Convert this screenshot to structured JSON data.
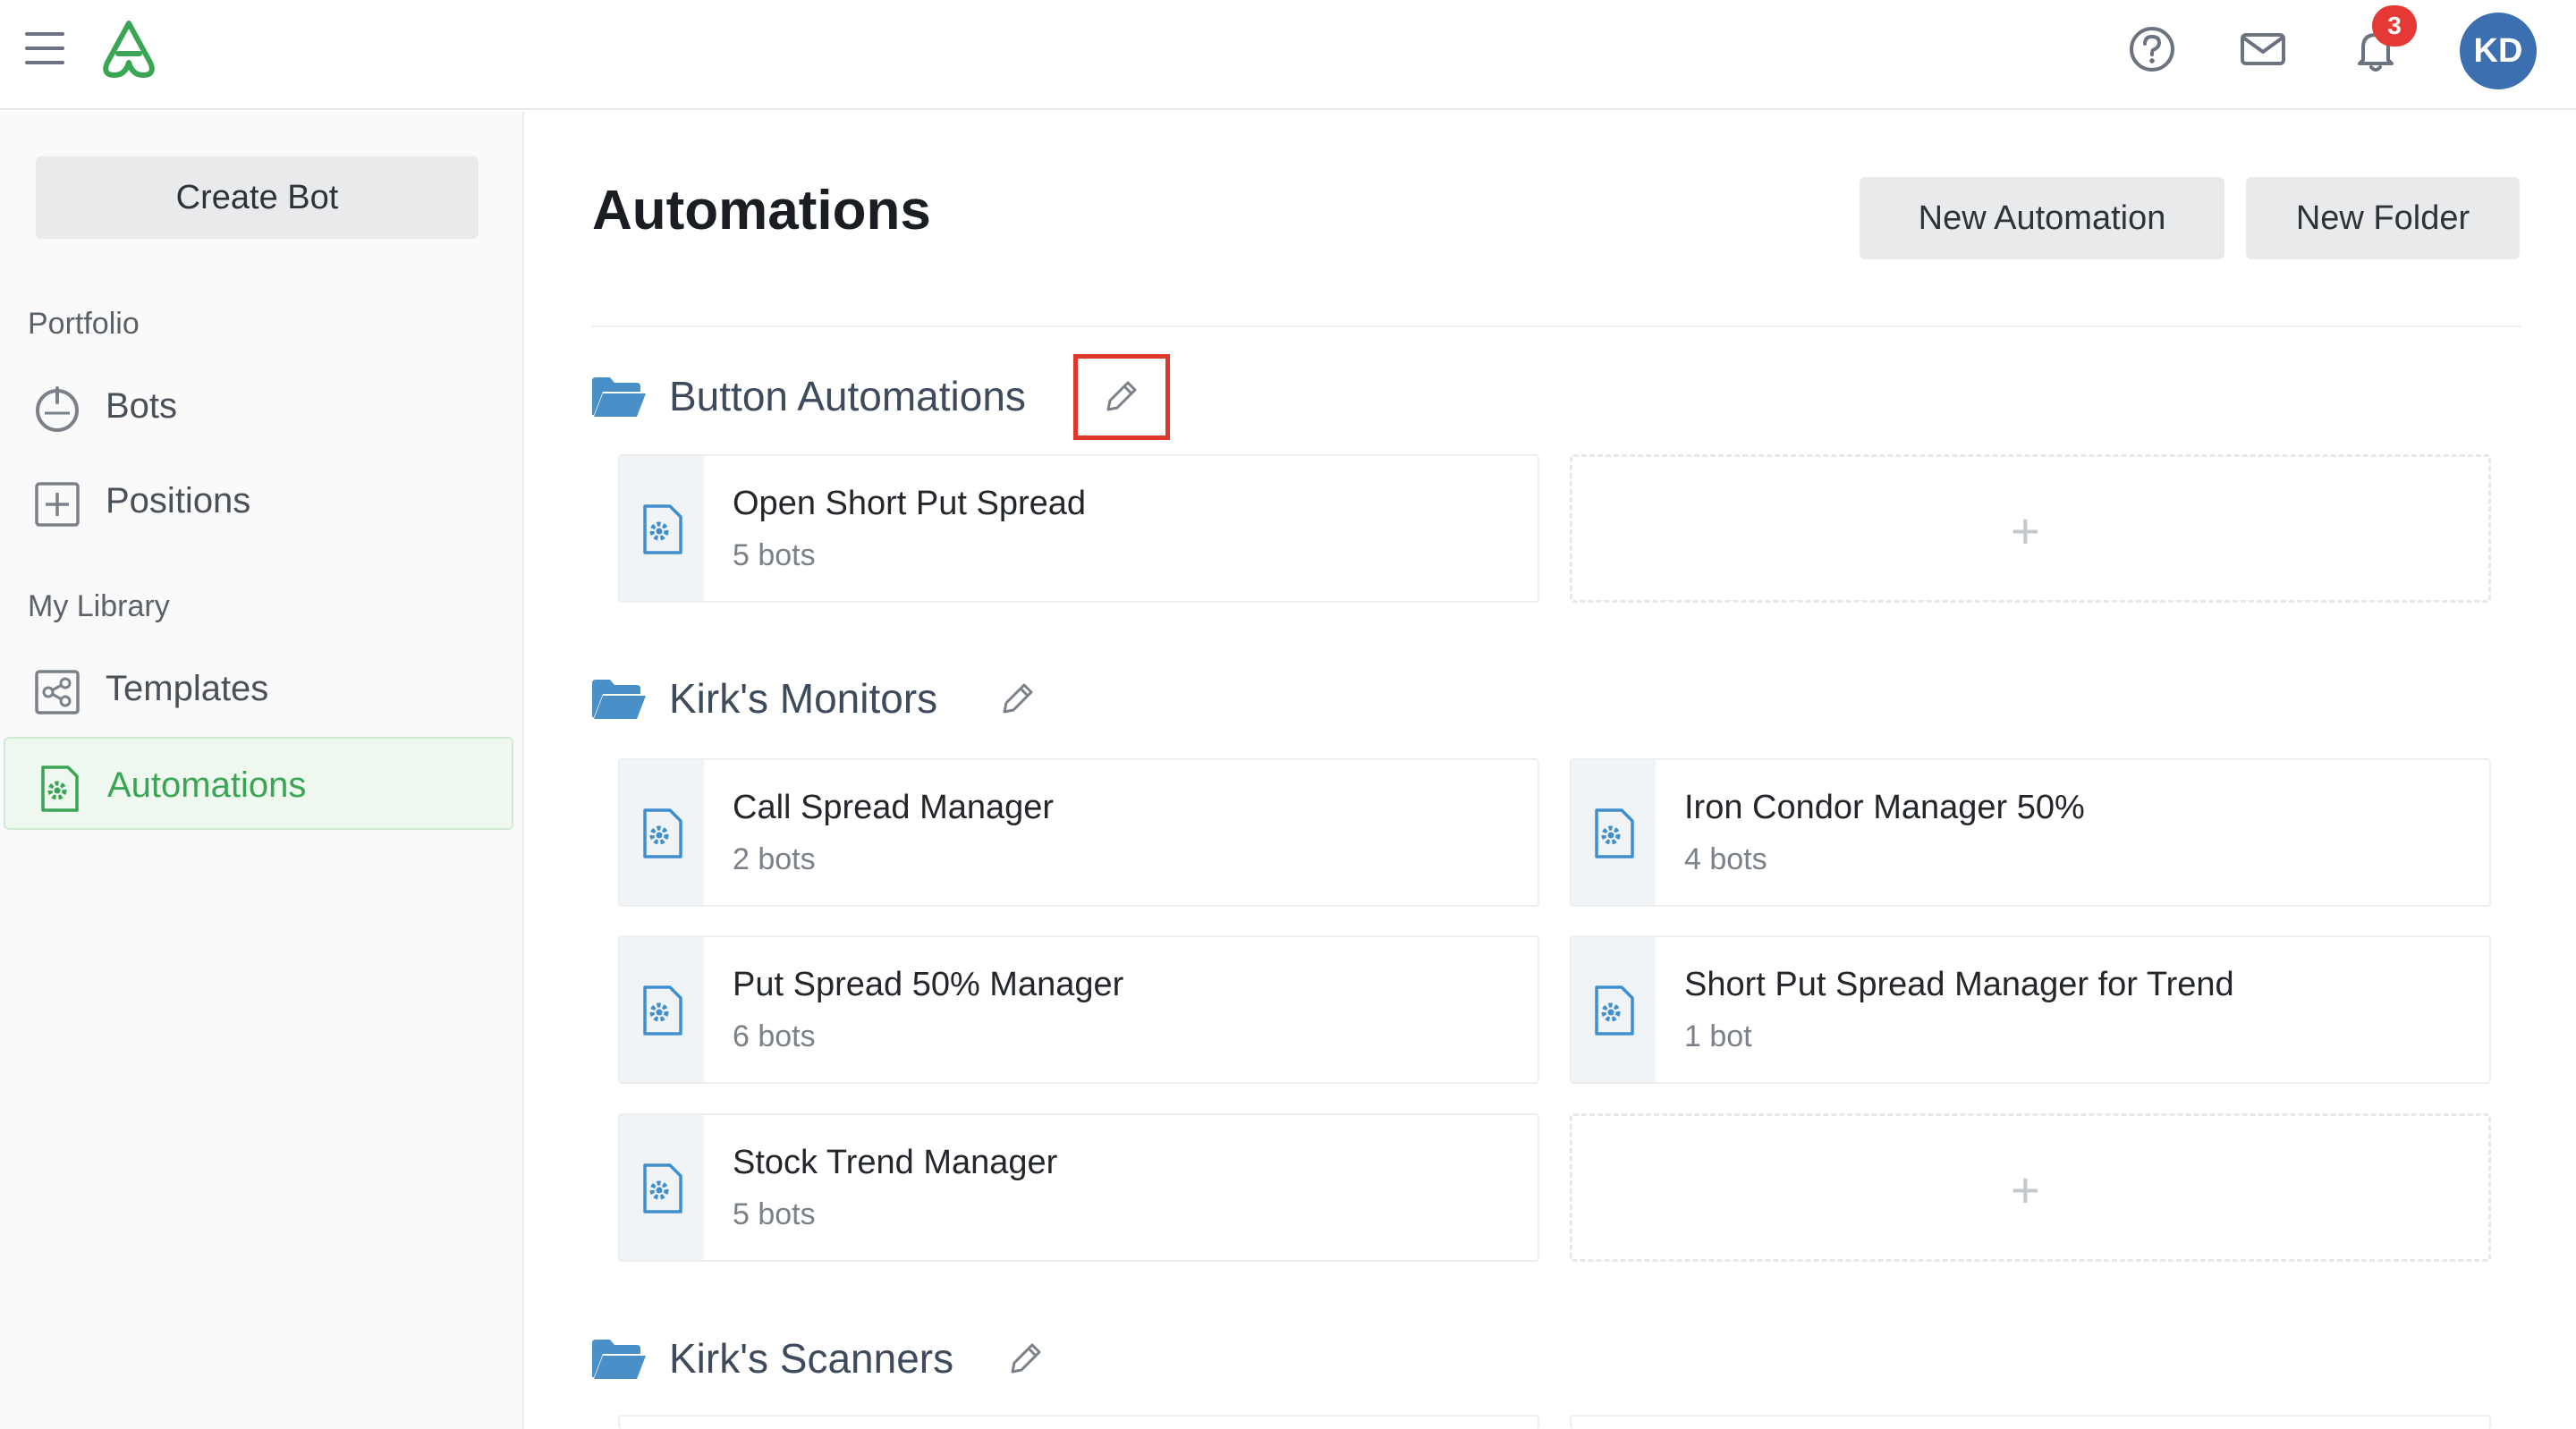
{
  "topbar": {
    "notification_count": "3",
    "avatar_initials": "KD",
    "brand_color": "#3aa655"
  },
  "sidebar": {
    "create_bot_label": "Create Bot",
    "portfolio_label": "Portfolio",
    "library_label": "My Library",
    "items": [
      {
        "label": "Bots",
        "icon": "power-icon"
      },
      {
        "label": "Positions",
        "icon": "plus-square-icon"
      },
      {
        "label": "Templates",
        "icon": "share-icon"
      },
      {
        "label": "Automations",
        "icon": "automation-gear-icon",
        "active": true
      }
    ]
  },
  "main": {
    "title": "Automations",
    "new_automation_label": "New Automation",
    "new_folder_label": "New Folder",
    "folders": [
      {
        "name": "Button Automations",
        "automations": [
          {
            "name": "Open Short Put Spread",
            "count": "5 bots"
          }
        ]
      },
      {
        "name": "Kirk's Monitors",
        "automations": [
          {
            "name": "Call Spread Manager",
            "count": "2 bots"
          },
          {
            "name": "Iron Condor Manager 50%",
            "count": "4 bots"
          },
          {
            "name": "Put Spread 50% Manager",
            "count": "6 bots"
          },
          {
            "name": "Short Put Spread Manager for Trend",
            "count": "1 bot"
          },
          {
            "name": "Stock Trend Manager",
            "count": "5 bots"
          }
        ]
      },
      {
        "name": "Kirk's Scanners",
        "automations": []
      }
    ],
    "add_card_symbol": "+"
  }
}
